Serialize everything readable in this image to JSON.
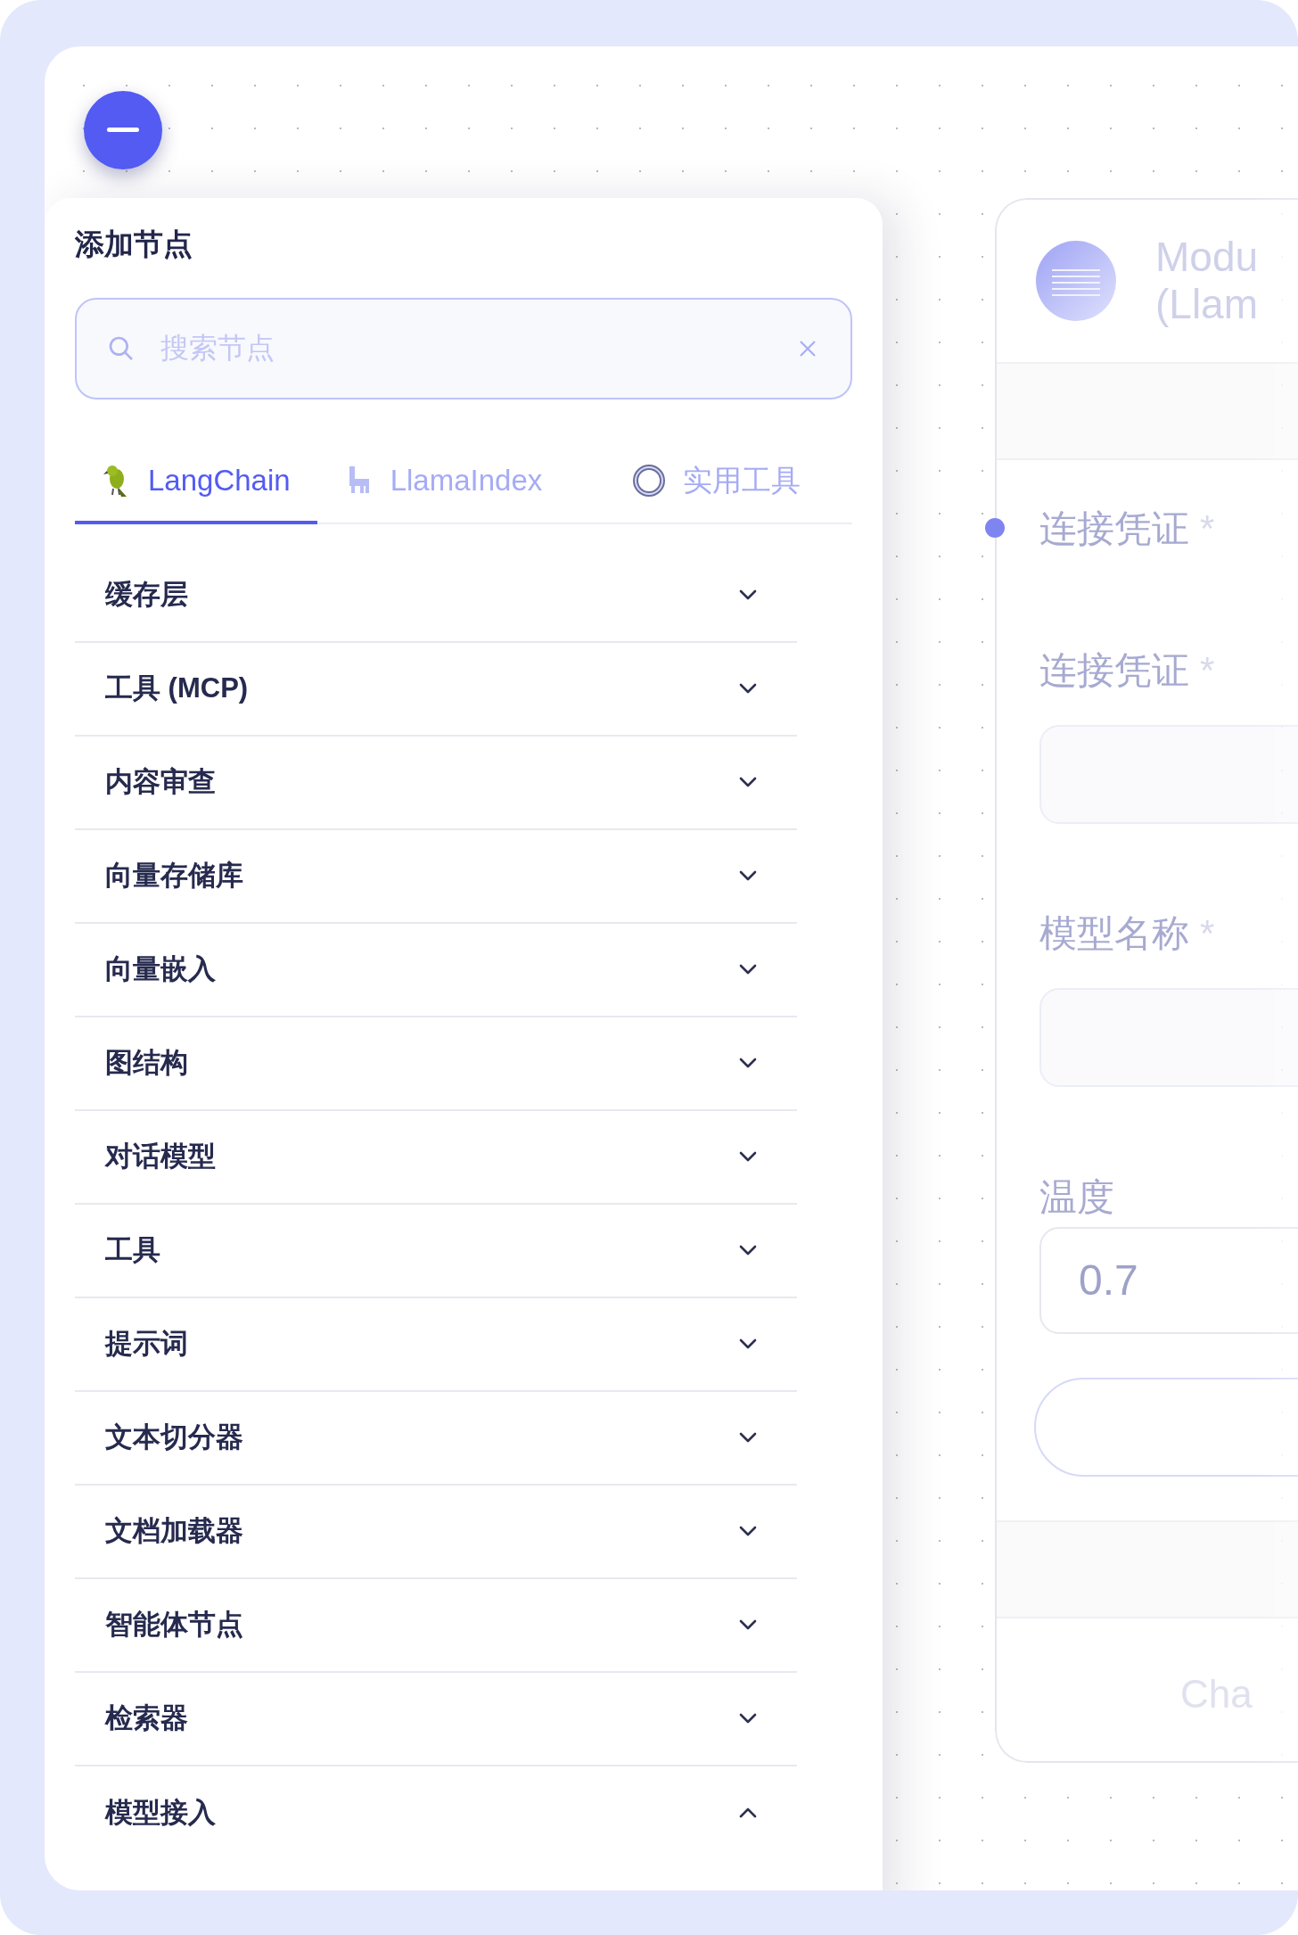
{
  "panel": {
    "title": "添加节点",
    "search": {
      "placeholder": "搜索节点"
    },
    "tabs": [
      {
        "label": "LangChain",
        "selected": true
      },
      {
        "label": "LlamaIndex",
        "selected": false
      },
      {
        "label": "实用工具",
        "selected": false
      }
    ],
    "categories": [
      {
        "label": "缓存层",
        "expanded": false
      },
      {
        "label": "工具 (MCP)",
        "expanded": false
      },
      {
        "label": "内容审查",
        "expanded": false
      },
      {
        "label": "向量存储库",
        "expanded": false
      },
      {
        "label": "向量嵌入",
        "expanded": false
      },
      {
        "label": "图结构",
        "expanded": false
      },
      {
        "label": "对话模型",
        "expanded": false
      },
      {
        "label": "工具",
        "expanded": false
      },
      {
        "label": "提示词",
        "expanded": false
      },
      {
        "label": "文本切分器",
        "expanded": false
      },
      {
        "label": "文档加载器",
        "expanded": false
      },
      {
        "label": "智能体节点",
        "expanded": false
      },
      {
        "label": "检索器",
        "expanded": false
      },
      {
        "label": "模型接入",
        "expanded": true
      }
    ]
  },
  "node": {
    "title_lines": [
      "Modu",
      "(Llam"
    ],
    "fields": [
      {
        "kind": "anchor",
        "label": "连接凭证",
        "required_mark": "*"
      },
      {
        "kind": "select",
        "label": "连接凭证",
        "required_mark": "*"
      },
      {
        "kind": "select",
        "label": "模型名称",
        "required_mark": "*"
      },
      {
        "kind": "number",
        "label": "温度",
        "value": "0.7"
      },
      {
        "kind": "button"
      }
    ],
    "footer": "Cha"
  }
}
